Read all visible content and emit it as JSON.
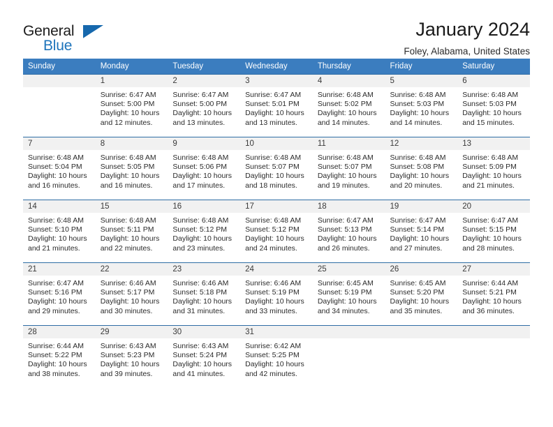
{
  "brand": {
    "name_part1": "General",
    "name_part2": "Blue",
    "logo_icon": "triangle-flag-icon"
  },
  "header": {
    "title": "January 2024",
    "subtitle": "Foley, Alabama, United States"
  },
  "calendar": {
    "header_bg": "#3b7dbf",
    "daynum_bg": "#f1f1f1",
    "row_border": "#2e6da4",
    "weekday_headers": [
      "Sunday",
      "Monday",
      "Tuesday",
      "Wednesday",
      "Thursday",
      "Friday",
      "Saturday"
    ],
    "weeks": [
      [
        {
          "day": "",
          "empty": true,
          "sunrise": "",
          "sunset": "",
          "daylight_line1": "",
          "daylight_line2": ""
        },
        {
          "day": "1",
          "sunrise": "Sunrise: 6:47 AM",
          "sunset": "Sunset: 5:00 PM",
          "daylight_line1": "Daylight: 10 hours",
          "daylight_line2": "and 12 minutes."
        },
        {
          "day": "2",
          "sunrise": "Sunrise: 6:47 AM",
          "sunset": "Sunset: 5:00 PM",
          "daylight_line1": "Daylight: 10 hours",
          "daylight_line2": "and 13 minutes."
        },
        {
          "day": "3",
          "sunrise": "Sunrise: 6:47 AM",
          "sunset": "Sunset: 5:01 PM",
          "daylight_line1": "Daylight: 10 hours",
          "daylight_line2": "and 13 minutes."
        },
        {
          "day": "4",
          "sunrise": "Sunrise: 6:48 AM",
          "sunset": "Sunset: 5:02 PM",
          "daylight_line1": "Daylight: 10 hours",
          "daylight_line2": "and 14 minutes."
        },
        {
          "day": "5",
          "sunrise": "Sunrise: 6:48 AM",
          "sunset": "Sunset: 5:03 PM",
          "daylight_line1": "Daylight: 10 hours",
          "daylight_line2": "and 14 minutes."
        },
        {
          "day": "6",
          "sunrise": "Sunrise: 6:48 AM",
          "sunset": "Sunset: 5:03 PM",
          "daylight_line1": "Daylight: 10 hours",
          "daylight_line2": "and 15 minutes."
        }
      ],
      [
        {
          "day": "7",
          "sunrise": "Sunrise: 6:48 AM",
          "sunset": "Sunset: 5:04 PM",
          "daylight_line1": "Daylight: 10 hours",
          "daylight_line2": "and 16 minutes."
        },
        {
          "day": "8",
          "sunrise": "Sunrise: 6:48 AM",
          "sunset": "Sunset: 5:05 PM",
          "daylight_line1": "Daylight: 10 hours",
          "daylight_line2": "and 16 minutes."
        },
        {
          "day": "9",
          "sunrise": "Sunrise: 6:48 AM",
          "sunset": "Sunset: 5:06 PM",
          "daylight_line1": "Daylight: 10 hours",
          "daylight_line2": "and 17 minutes."
        },
        {
          "day": "10",
          "sunrise": "Sunrise: 6:48 AM",
          "sunset": "Sunset: 5:07 PM",
          "daylight_line1": "Daylight: 10 hours",
          "daylight_line2": "and 18 minutes."
        },
        {
          "day": "11",
          "sunrise": "Sunrise: 6:48 AM",
          "sunset": "Sunset: 5:07 PM",
          "daylight_line1": "Daylight: 10 hours",
          "daylight_line2": "and 19 minutes."
        },
        {
          "day": "12",
          "sunrise": "Sunrise: 6:48 AM",
          "sunset": "Sunset: 5:08 PM",
          "daylight_line1": "Daylight: 10 hours",
          "daylight_line2": "and 20 minutes."
        },
        {
          "day": "13",
          "sunrise": "Sunrise: 6:48 AM",
          "sunset": "Sunset: 5:09 PM",
          "daylight_line1": "Daylight: 10 hours",
          "daylight_line2": "and 21 minutes."
        }
      ],
      [
        {
          "day": "14",
          "sunrise": "Sunrise: 6:48 AM",
          "sunset": "Sunset: 5:10 PM",
          "daylight_line1": "Daylight: 10 hours",
          "daylight_line2": "and 21 minutes."
        },
        {
          "day": "15",
          "sunrise": "Sunrise: 6:48 AM",
          "sunset": "Sunset: 5:11 PM",
          "daylight_line1": "Daylight: 10 hours",
          "daylight_line2": "and 22 minutes."
        },
        {
          "day": "16",
          "sunrise": "Sunrise: 6:48 AM",
          "sunset": "Sunset: 5:12 PM",
          "daylight_line1": "Daylight: 10 hours",
          "daylight_line2": "and 23 minutes."
        },
        {
          "day": "17",
          "sunrise": "Sunrise: 6:48 AM",
          "sunset": "Sunset: 5:12 PM",
          "daylight_line1": "Daylight: 10 hours",
          "daylight_line2": "and 24 minutes."
        },
        {
          "day": "18",
          "sunrise": "Sunrise: 6:47 AM",
          "sunset": "Sunset: 5:13 PM",
          "daylight_line1": "Daylight: 10 hours",
          "daylight_line2": "and 26 minutes."
        },
        {
          "day": "19",
          "sunrise": "Sunrise: 6:47 AM",
          "sunset": "Sunset: 5:14 PM",
          "daylight_line1": "Daylight: 10 hours",
          "daylight_line2": "and 27 minutes."
        },
        {
          "day": "20",
          "sunrise": "Sunrise: 6:47 AM",
          "sunset": "Sunset: 5:15 PM",
          "daylight_line1": "Daylight: 10 hours",
          "daylight_line2": "and 28 minutes."
        }
      ],
      [
        {
          "day": "21",
          "sunrise": "Sunrise: 6:47 AM",
          "sunset": "Sunset: 5:16 PM",
          "daylight_line1": "Daylight: 10 hours",
          "daylight_line2": "and 29 minutes."
        },
        {
          "day": "22",
          "sunrise": "Sunrise: 6:46 AM",
          "sunset": "Sunset: 5:17 PM",
          "daylight_line1": "Daylight: 10 hours",
          "daylight_line2": "and 30 minutes."
        },
        {
          "day": "23",
          "sunrise": "Sunrise: 6:46 AM",
          "sunset": "Sunset: 5:18 PM",
          "daylight_line1": "Daylight: 10 hours",
          "daylight_line2": "and 31 minutes."
        },
        {
          "day": "24",
          "sunrise": "Sunrise: 6:46 AM",
          "sunset": "Sunset: 5:19 PM",
          "daylight_line1": "Daylight: 10 hours",
          "daylight_line2": "and 33 minutes."
        },
        {
          "day": "25",
          "sunrise": "Sunrise: 6:45 AM",
          "sunset": "Sunset: 5:19 PM",
          "daylight_line1": "Daylight: 10 hours",
          "daylight_line2": "and 34 minutes."
        },
        {
          "day": "26",
          "sunrise": "Sunrise: 6:45 AM",
          "sunset": "Sunset: 5:20 PM",
          "daylight_line1": "Daylight: 10 hours",
          "daylight_line2": "and 35 minutes."
        },
        {
          "day": "27",
          "sunrise": "Sunrise: 6:44 AM",
          "sunset": "Sunset: 5:21 PM",
          "daylight_line1": "Daylight: 10 hours",
          "daylight_line2": "and 36 minutes."
        }
      ],
      [
        {
          "day": "28",
          "sunrise": "Sunrise: 6:44 AM",
          "sunset": "Sunset: 5:22 PM",
          "daylight_line1": "Daylight: 10 hours",
          "daylight_line2": "and 38 minutes."
        },
        {
          "day": "29",
          "sunrise": "Sunrise: 6:43 AM",
          "sunset": "Sunset: 5:23 PM",
          "daylight_line1": "Daylight: 10 hours",
          "daylight_line2": "and 39 minutes."
        },
        {
          "day": "30",
          "sunrise": "Sunrise: 6:43 AM",
          "sunset": "Sunset: 5:24 PM",
          "daylight_line1": "Daylight: 10 hours",
          "daylight_line2": "and 41 minutes."
        },
        {
          "day": "31",
          "sunrise": "Sunrise: 6:42 AM",
          "sunset": "Sunset: 5:25 PM",
          "daylight_line1": "Daylight: 10 hours",
          "daylight_line2": "and 42 minutes."
        },
        {
          "day": "",
          "empty": true,
          "sunrise": "",
          "sunset": "",
          "daylight_line1": "",
          "daylight_line2": ""
        },
        {
          "day": "",
          "empty": true,
          "sunrise": "",
          "sunset": "",
          "daylight_line1": "",
          "daylight_line2": ""
        },
        {
          "day": "",
          "empty": true,
          "sunrise": "",
          "sunset": "",
          "daylight_line1": "",
          "daylight_line2": ""
        }
      ]
    ]
  }
}
